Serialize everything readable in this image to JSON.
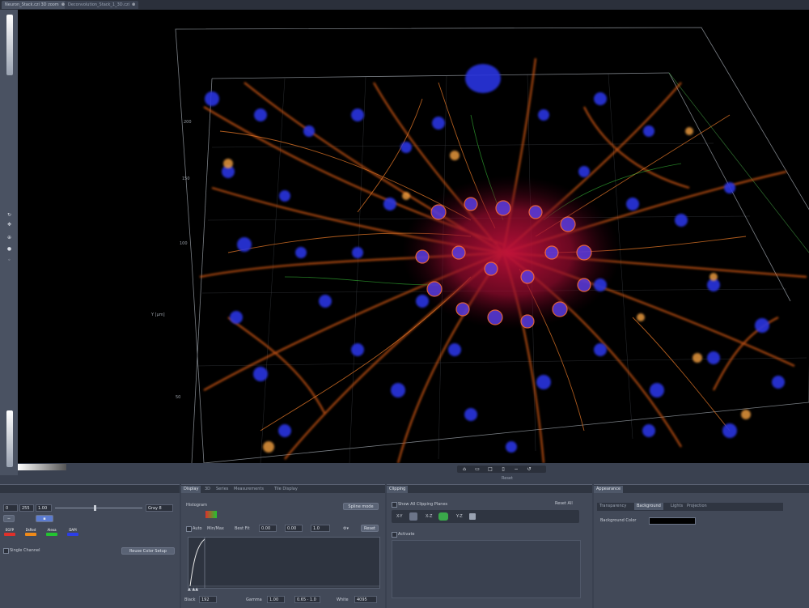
{
  "tabs": [
    {
      "label": "Neuron_Stack.czi 3D zoom",
      "active": true
    },
    {
      "label": "Deconvolution_Stack_1_3D.czi",
      "active": false
    }
  ],
  "viewport": {
    "axis_ticks": [
      "200",
      "150",
      "100",
      "50"
    ],
    "axis_label": "Y [µm]",
    "toolbar_label": "Reset"
  },
  "left_panel": {
    "display_values": [
      "0",
      "255",
      "1.00"
    ],
    "mode_select": "Gray 8",
    "channels": [
      {
        "label": "EGFP",
        "color": "#e0302a"
      },
      {
        "label": "DsRed",
        "color": "#f08a18"
      },
      {
        "label": "Alexa",
        "color": "#22c430"
      },
      {
        "label": "DAPI",
        "color": "#2c3ee8"
      }
    ],
    "single_channel": "Single Channel",
    "reuse_button": "Reuse Color Setup"
  },
  "display_panel": {
    "tabs": [
      "Display",
      "3D",
      "Series",
      "Measurements",
      "Tile Display"
    ],
    "section_title": "Histogram",
    "spline_button": "Spline mode",
    "min_max_label": "Min/Max",
    "best_fit_label": "Best Fit",
    "best_fit_value": "0.00",
    "percent_value": "0.00",
    "gamma_box": "1.0",
    "reset_button": "Reset",
    "mode_label": "Auto",
    "black_label": "Black",
    "black_value": "192",
    "gamma_label": "Gamma",
    "gamma_value": "1.00",
    "white_label": "White",
    "white_value": "4095",
    "gamma_extra": "0.65 · 1.0"
  },
  "clipping_panel": {
    "tabs": [
      "Clipping"
    ],
    "show_all": "Show All Clipping Planes",
    "reset_all": "Reset All",
    "planes": [
      "X-Y",
      "X-Z",
      "Y-Z"
    ],
    "activate": "Activate"
  },
  "appearance_panel": {
    "title": "Appearance",
    "tabs": [
      "Transparency",
      "Background",
      "Lights",
      "Projection"
    ],
    "bg_label": "Background Color"
  }
}
